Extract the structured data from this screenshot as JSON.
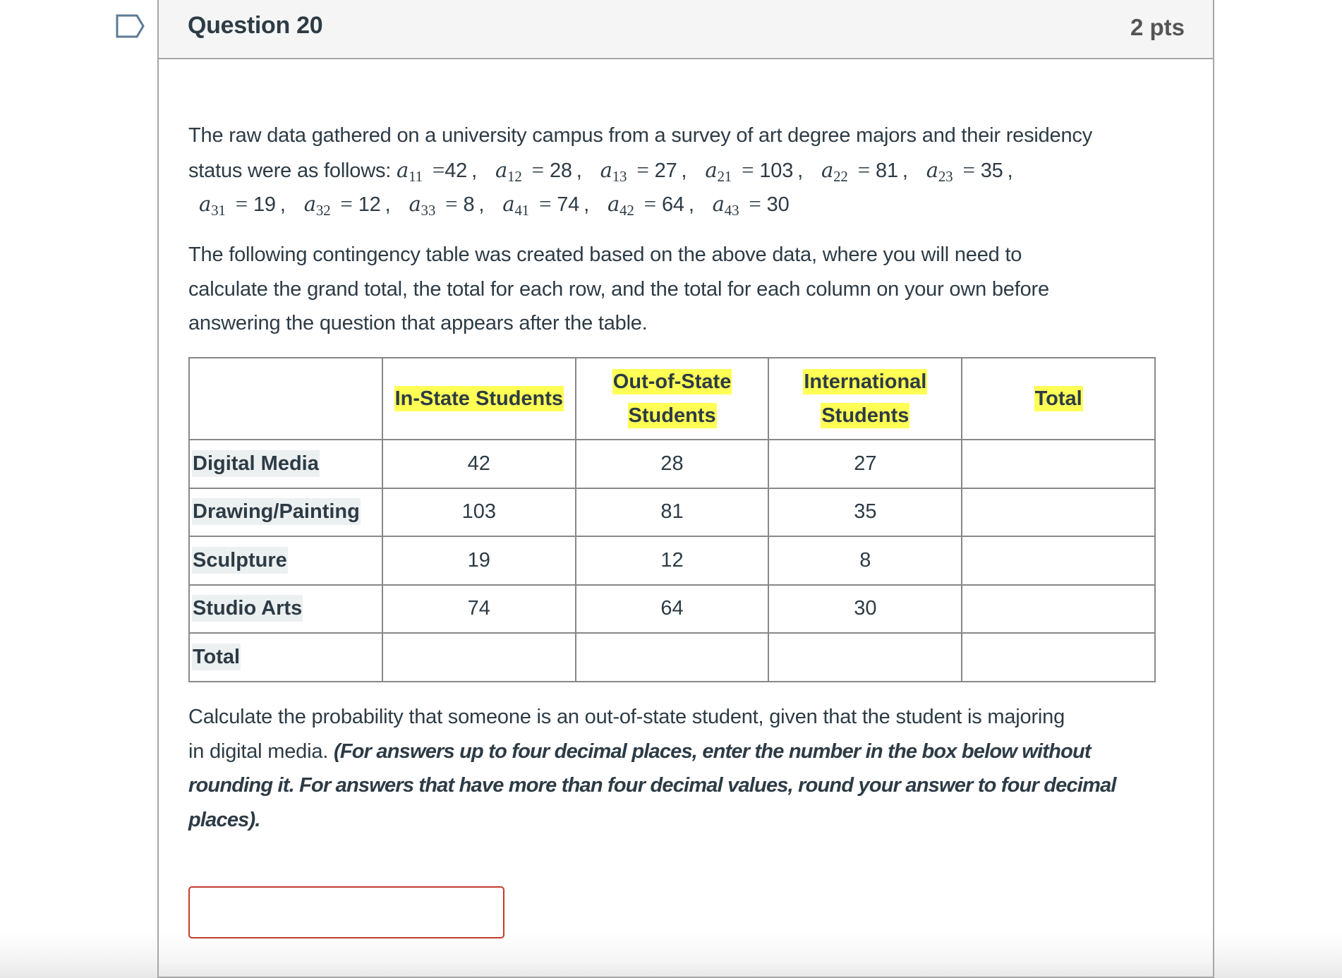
{
  "question": {
    "title": "Question 20",
    "points": "2 pts",
    "flag_icon": "bookmark-flag-icon"
  },
  "intro": {
    "line1": "The raw data gathered on a university campus from a survey of art degree majors and their residency",
    "line2_prefix": "status were as follows: ",
    "values": [
      {
        "sub": "11",
        "eq": "=",
        "val": "42"
      },
      {
        "sub": "12",
        "eq": "=",
        "val": "28"
      },
      {
        "sub": "13",
        "eq": "=",
        "val": "27"
      },
      {
        "sub": "21",
        "eq": "=",
        "val": "103"
      },
      {
        "sub": "22",
        "eq": "=",
        "val": "81"
      },
      {
        "sub": "23",
        "eq": "=",
        "val": "35"
      },
      {
        "sub": "31",
        "eq": "=",
        "val": "19"
      },
      {
        "sub": "32",
        "eq": "=",
        "val": "12"
      },
      {
        "sub": "33",
        "eq": "=",
        "val": "8"
      },
      {
        "sub": "41",
        "eq": "=",
        "val": "74"
      },
      {
        "sub": "42",
        "eq": "=",
        "val": "64"
      },
      {
        "sub": "43",
        "eq": "=",
        "val": "30"
      }
    ],
    "var_symbol": "a"
  },
  "instructions": {
    "line1": "The following contingency table was created based on the above data, where you will need to",
    "line2": "calculate the grand total, the total for each row, and the total for each column on your own before",
    "line3": "answering the question that appears after the table."
  },
  "table": {
    "headers": [
      "",
      "In-State Students",
      "Out-of-State Students",
      "International Students",
      "Total"
    ],
    "header_lines": [
      [
        ""
      ],
      [
        "In-State Students"
      ],
      [
        "Out-of-State",
        "Students"
      ],
      [
        "International",
        "Students"
      ],
      [
        "Total"
      ]
    ],
    "rows": [
      {
        "label": "Digital Media",
        "values": [
          "42",
          "28",
          "27",
          ""
        ]
      },
      {
        "label": "Drawing/Painting",
        "values": [
          "103",
          "81",
          "35",
          ""
        ]
      },
      {
        "label": "Sculpture",
        "values": [
          "19",
          "12",
          "8",
          ""
        ]
      },
      {
        "label": "Studio Arts",
        "values": [
          "74",
          "64",
          "30",
          ""
        ]
      },
      {
        "label": "Total",
        "values": [
          "",
          "",
          "",
          ""
        ]
      }
    ]
  },
  "prompt": {
    "line1": "Calculate the probability that someone is an out-of-state student, given that the student is majoring",
    "line2_plain": "in digital media. ",
    "line2_bold": "(For answers up to four decimal places, enter the number in the box below without",
    "line3_bold": "rounding it. For answers that have more than four decimal values, round your answer to four decimal",
    "line4_bold": "places)."
  },
  "answer": {
    "value": "",
    "placeholder": "",
    "border_color": "#c23c2d"
  }
}
